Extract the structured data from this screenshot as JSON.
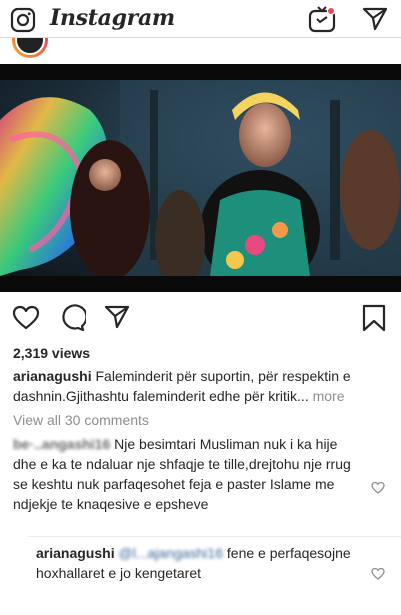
{
  "header": {
    "logo_text": "Instagram",
    "camera_icon": "camera-icon",
    "igtv_icon": "igtv-icon",
    "direct_icon": "direct-send-icon",
    "notification_dot_color": "#ed4956"
  },
  "post": {
    "actions": {
      "like_icon": "heart-icon",
      "comment_icon": "comment-icon",
      "share_icon": "send-icon",
      "save_icon": "bookmark-icon"
    },
    "views": "2,319 views",
    "caption": {
      "username": "arianagushi",
      "text": "Faleminderit për suportin, për respektin e dashnin.Gjithashtu faleminderit edhe për kritik...",
      "more_label": "more"
    },
    "view_all_comments": "View all 30 comments",
    "comments": [
      {
        "username": "be·..angashi16",
        "text": " Nje besimtari Musliman nuk i ka hije dhe e ka te ndaluar nje shfaqje te tille,drejtohu nje rrug se keshtu nuk parfaqesohet feja e paster Islame me ndjekje te knaqesive e epsheve"
      },
      {
        "username": "arianagushi",
        "mention": "@l...ajangashi16",
        "text": " fene e perfaqesojne hoxhallaret e jo kengetaret"
      }
    ]
  }
}
